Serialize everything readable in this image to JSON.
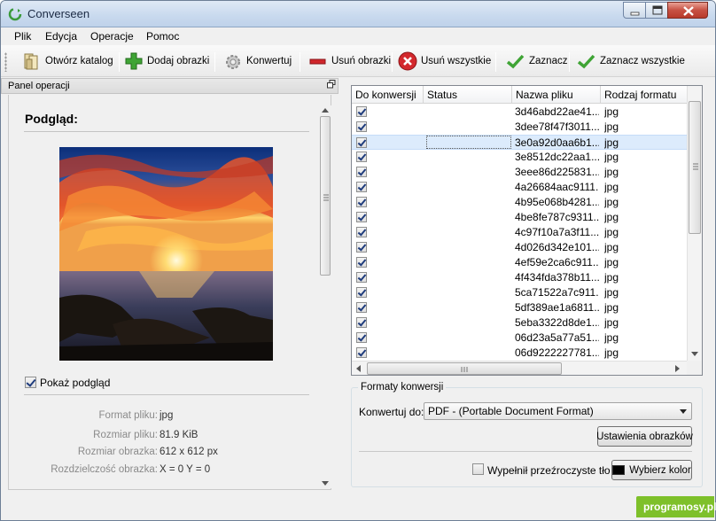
{
  "window": {
    "title": "Converseen"
  },
  "menu": [
    "Plik",
    "Edycja",
    "Operacje",
    "Pomoc"
  ],
  "toolbar": {
    "open_dir": "Otwórz katalog",
    "add_images": "Dodaj obrazki",
    "convert": "Konwertuj",
    "remove_images": "Usuń obrazki",
    "remove_all": "Usuń wszystkie",
    "check": "Zaznacz",
    "check_all": "Zaznacz wszystkie"
  },
  "panel": {
    "title": "Panel operacji",
    "preview_heading": "Podgląd:",
    "show_preview": "Pokaż podgląd",
    "show_preview_checked": true,
    "info": [
      {
        "label": "Format pliku:",
        "value": "jpg"
      },
      {
        "label": "Rozmiar pliku:",
        "value": "81.9 KiB"
      },
      {
        "label": "Rozmiar obrazka:",
        "value": "612 x 612 px"
      },
      {
        "label": "Rozdzielczość obrazka:",
        "value": "X = 0 Y = 0"
      }
    ]
  },
  "table": {
    "headers": [
      "Do konwersji",
      "Status",
      "Nazwa pliku",
      "Rodzaj formatu"
    ],
    "selected_index": 2,
    "rows": [
      {
        "checked": true,
        "status": "",
        "name": "3d46abd22ae41...",
        "format": "jpg"
      },
      {
        "checked": true,
        "status": "",
        "name": "3dee78f47f3011...",
        "format": "jpg"
      },
      {
        "checked": true,
        "status": "",
        "name": "3e0a92d0aa6b1...",
        "format": "jpg"
      },
      {
        "checked": true,
        "status": "",
        "name": "3e8512dc22aa1...",
        "format": "jpg"
      },
      {
        "checked": true,
        "status": "",
        "name": "3eee86d225831...",
        "format": "jpg"
      },
      {
        "checked": true,
        "status": "",
        "name": "4a26684aac9111...",
        "format": "jpg"
      },
      {
        "checked": true,
        "status": "",
        "name": "4b95e068b4281...",
        "format": "jpg"
      },
      {
        "checked": true,
        "status": "",
        "name": "4be8fe787c9311...",
        "format": "jpg"
      },
      {
        "checked": true,
        "status": "",
        "name": "4c97f10a7a3f11...",
        "format": "jpg"
      },
      {
        "checked": true,
        "status": "",
        "name": "4d026d342e101...",
        "format": "jpg"
      },
      {
        "checked": true,
        "status": "",
        "name": "4ef59e2ca6c911...",
        "format": "jpg"
      },
      {
        "checked": true,
        "status": "",
        "name": "4f434fda378b11...",
        "format": "jpg"
      },
      {
        "checked": true,
        "status": "",
        "name": "5ca71522a7c911...",
        "format": "jpg"
      },
      {
        "checked": true,
        "status": "",
        "name": "5df389ae1a6811...",
        "format": "jpg"
      },
      {
        "checked": true,
        "status": "",
        "name": "5eba3322d8de1...",
        "format": "jpg"
      },
      {
        "checked": true,
        "status": "",
        "name": "06d23a5a77a51...",
        "format": "jpg"
      },
      {
        "checked": true,
        "status": "",
        "name": "06d9222227781...",
        "format": "jpg"
      }
    ]
  },
  "formats": {
    "group_title": "Formaty konwersji",
    "convert_to_label": "Konwertuj do:",
    "convert_to_value": "PDF - (Portable Document Format)",
    "image_settings": "Ustawienia obrazków",
    "fill_transparent": "Wypełnił przeźroczyste tło",
    "fill_transparent_checked": false,
    "choose_color": "Wybierz kolor",
    "color": "#000000"
  },
  "watermark": "programosy.pl"
}
